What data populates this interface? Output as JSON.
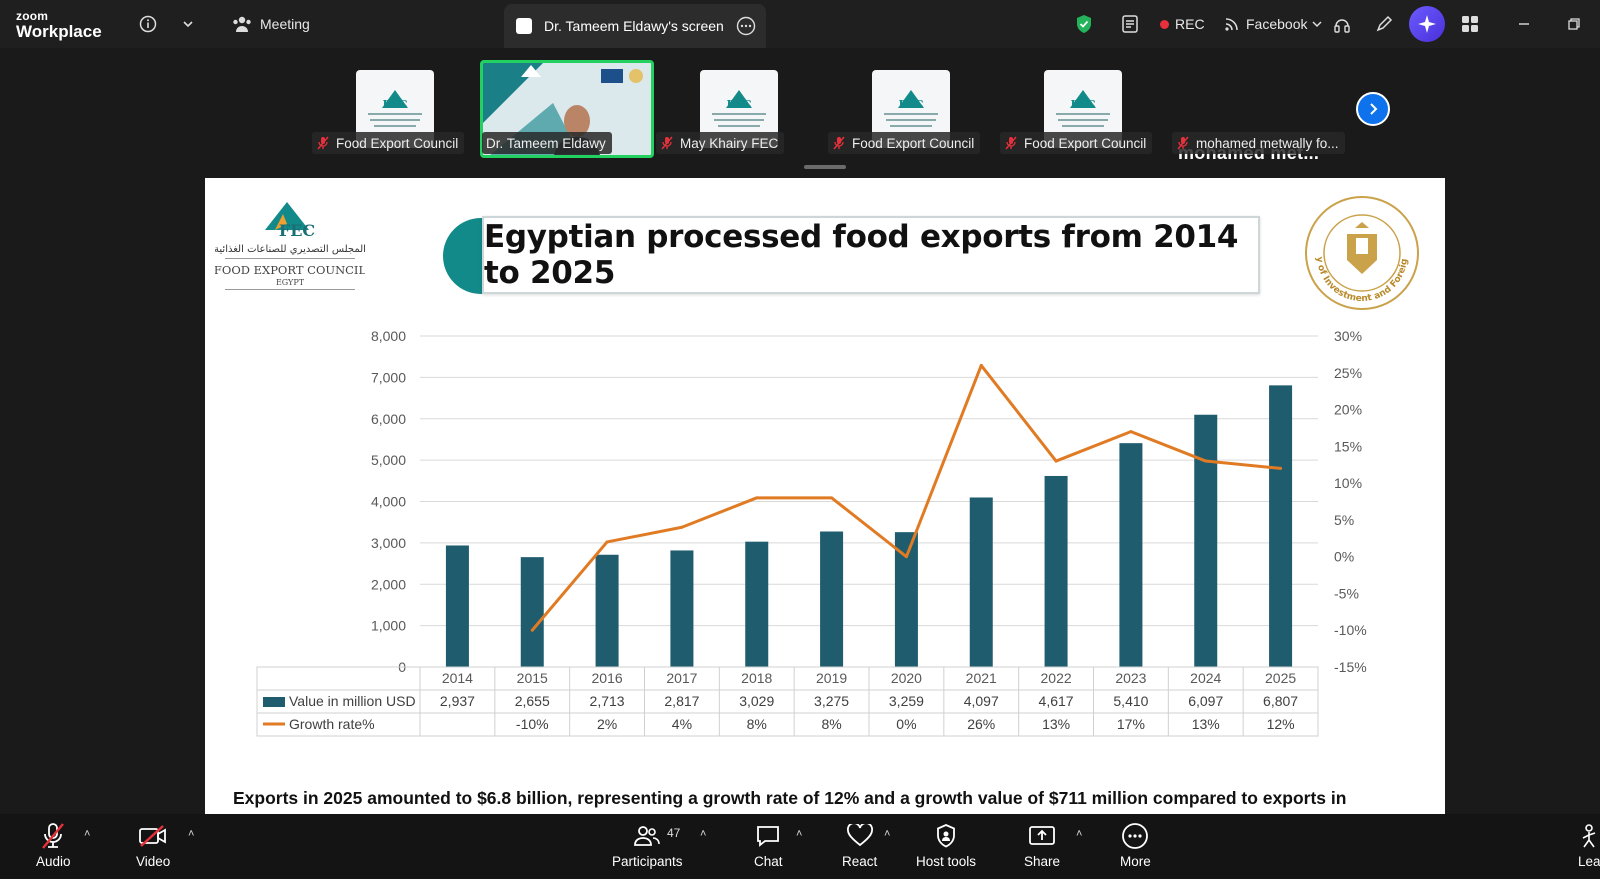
{
  "app": {
    "brand_small": "zoom",
    "brand_big": "Workplace"
  },
  "topbar": {
    "meeting_label": "Meeting",
    "screen_tab_label": "Dr. Tameem Eldawy's screen",
    "rec_label": "REC",
    "stream_label": "Facebook"
  },
  "participants_strip": {
    "tiles": [
      {
        "name": "Food Export Council"
      },
      {
        "name": "Dr. Tameem Eldawy"
      },
      {
        "name": "May Khairy FEC"
      },
      {
        "name": "Food Export Council"
      },
      {
        "name": "Food Export Council"
      },
      {
        "name": "mohamed metwally fo..."
      }
    ],
    "big_name": "mohamed   met..."
  },
  "slide": {
    "title": "Egyptian processed food exports from 2014 to 2025",
    "footer": "Exports in 2025 amounted to $6.8 billion, representing a growth rate of 12% and a growth value of $711 million compared to exports in",
    "logo_text": {
      "arabic": "المجلس التصديري للصناعات الغذائية",
      "en": "FOOD EXPORT COUNCIL",
      "country": "EGYPT",
      "abbr": "FEC"
    },
    "seal_text": "Ministry of Investment and Foreign Trade"
  },
  "chart_data": {
    "type": "bar",
    "categories": [
      "2014",
      "2015",
      "2016",
      "2017",
      "2018",
      "2019",
      "2020",
      "2021",
      "2022",
      "2023",
      "2024",
      "2025"
    ],
    "series": [
      {
        "name": "Value in million USD",
        "type": "bar",
        "axis": "left",
        "values": [
          2937,
          2655,
          2713,
          2817,
          3029,
          3275,
          3259,
          4097,
          4617,
          5410,
          6097,
          6807
        ],
        "labels": [
          "2,937",
          "2,655",
          "2,713",
          "2,817",
          "3,029",
          "3,275",
          "3,259",
          "4,097",
          "4,617",
          "5,410",
          "6,097",
          "6,807"
        ],
        "color": "#1f5c6e"
      },
      {
        "name": "Growth rate%",
        "type": "line",
        "axis": "right",
        "values": [
          null,
          -10,
          2,
          4,
          8,
          8,
          0,
          26,
          13,
          17,
          13,
          12
        ],
        "labels": [
          "",
          "-10%",
          "2%",
          "4%",
          "8%",
          "8%",
          "0%",
          "26%",
          "13%",
          "17%",
          "13%",
          "12%"
        ],
        "color": "#e07b24"
      }
    ],
    "y_left": {
      "min": 0,
      "max": 8000,
      "ticks": [
        "0",
        "1,000",
        "2,000",
        "3,000",
        "4,000",
        "5,000",
        "6,000",
        "7,000",
        "8,000"
      ]
    },
    "y_right": {
      "min": -15,
      "max": 30,
      "ticks": [
        "-15%",
        "-10%",
        "-5%",
        "0%",
        "5%",
        "10%",
        "15%",
        "20%",
        "25%",
        "30%"
      ]
    },
    "grid": true,
    "legend": "data-table"
  },
  "bottombar": {
    "audio": "Audio",
    "video": "Video",
    "participants": "Participants",
    "participants_count": "47",
    "chat": "Chat",
    "react": "React",
    "host_tools": "Host tools",
    "share": "Share",
    "more": "More",
    "leave": "Lea"
  },
  "colors": {
    "accent": "#0e72ed",
    "speaker_border": "#23d160",
    "rec": "#e8303c",
    "bar": "#1f5c6e",
    "line": "#e07b24",
    "teal": "#138a8a"
  }
}
